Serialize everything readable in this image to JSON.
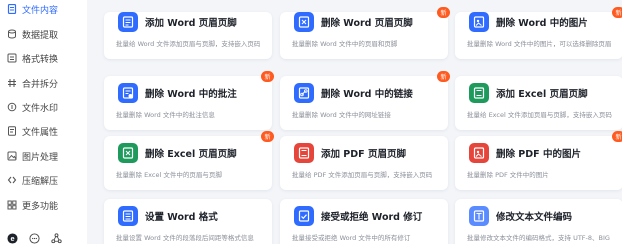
{
  "sidebar": {
    "items": [
      {
        "label": "文件内容",
        "icon": "file-content-icon",
        "active": true
      },
      {
        "label": "数据提取",
        "icon": "data-extract-icon"
      },
      {
        "label": "格式转换",
        "icon": "format-convert-icon"
      },
      {
        "label": "合并拆分",
        "icon": "merge-split-icon"
      },
      {
        "label": "文件水印",
        "icon": "watermark-icon"
      },
      {
        "label": "文件属性",
        "icon": "file-properties-icon"
      },
      {
        "label": "图片处理",
        "icon": "image-process-icon"
      },
      {
        "label": "压缩解压",
        "icon": "compress-icon"
      },
      {
        "label": "更多功能",
        "icon": "more-features-icon"
      }
    ],
    "bottom_icons": [
      "e-logo-icon",
      "chat-icon",
      "share-icon"
    ]
  },
  "cards": [
    {
      "title": "添加 Word 页眉页脚",
      "desc": "批量给 Word 文件添加页眉与页脚，支持嵌入页码",
      "badge": "",
      "color": "#2f6bff",
      "icon": "word-header-add-icon"
    },
    {
      "title": "删除 Word 页眉页脚",
      "desc": "批量删除 Word 文件中的页眉和页脚",
      "badge": "新",
      "color": "#2f6bff",
      "icon": "word-header-remove-icon"
    },
    {
      "title": "删除 Word 中的图片",
      "desc": "批量删除 Word 文件中的图片，可以选择删除页眉",
      "badge": "新",
      "color": "#2f6bff",
      "icon": "word-image-remove-icon"
    },
    {
      "title": "删除 Word 中的批注",
      "desc": "批量删除 Word 文件中的批注信息",
      "badge": "新",
      "color": "#2f6bff",
      "icon": "word-comment-remove-icon"
    },
    {
      "title": "删除 Word 中的链接",
      "desc": "批量删除 Word 文件中的网址链接",
      "badge": "新",
      "color": "#2f6bff",
      "icon": "word-link-remove-icon"
    },
    {
      "title": "添加 Excel 页眉页脚",
      "desc": "批量给 Excel 文件添加页眉与页脚，支持嵌入页码",
      "badge": "",
      "color": "#1e9b5c",
      "icon": "excel-header-add-icon"
    },
    {
      "title": "删除 Excel 页眉页脚",
      "desc": "批量删除 Excel 文件中的页眉与页脚",
      "badge": "新",
      "color": "#1e9b5c",
      "icon": "excel-header-remove-icon"
    },
    {
      "title": "添加 PDF 页眉页脚",
      "desc": "批量给 PDF 文件添加页眉与页脚，支持嵌入页码",
      "badge": "",
      "color": "#e5453a",
      "icon": "pdf-header-add-icon"
    },
    {
      "title": "删除 PDF 中的图片",
      "desc": "批量删除 PDF 文件中的图片",
      "badge": "新",
      "color": "#e5453a",
      "icon": "pdf-image-remove-icon"
    },
    {
      "title": "设置 Word 格式",
      "desc": "批量设置 Word 文件的段落段后间距等格式信息",
      "badge": "",
      "color": "#2f6bff",
      "icon": "word-format-icon"
    },
    {
      "title": "接受或拒绝 Word 修订",
      "desc": "批量接受或拒绝 Word 文件中的所有修订",
      "badge": "",
      "color": "#2f6bff",
      "icon": "word-revision-icon"
    },
    {
      "title": "修改文本文件编码",
      "desc": "批量修改文本文件的编码格式，支持 UTF-8、BIG",
      "badge": "",
      "color": "#5b8cff",
      "icon": "text-encoding-icon"
    }
  ]
}
